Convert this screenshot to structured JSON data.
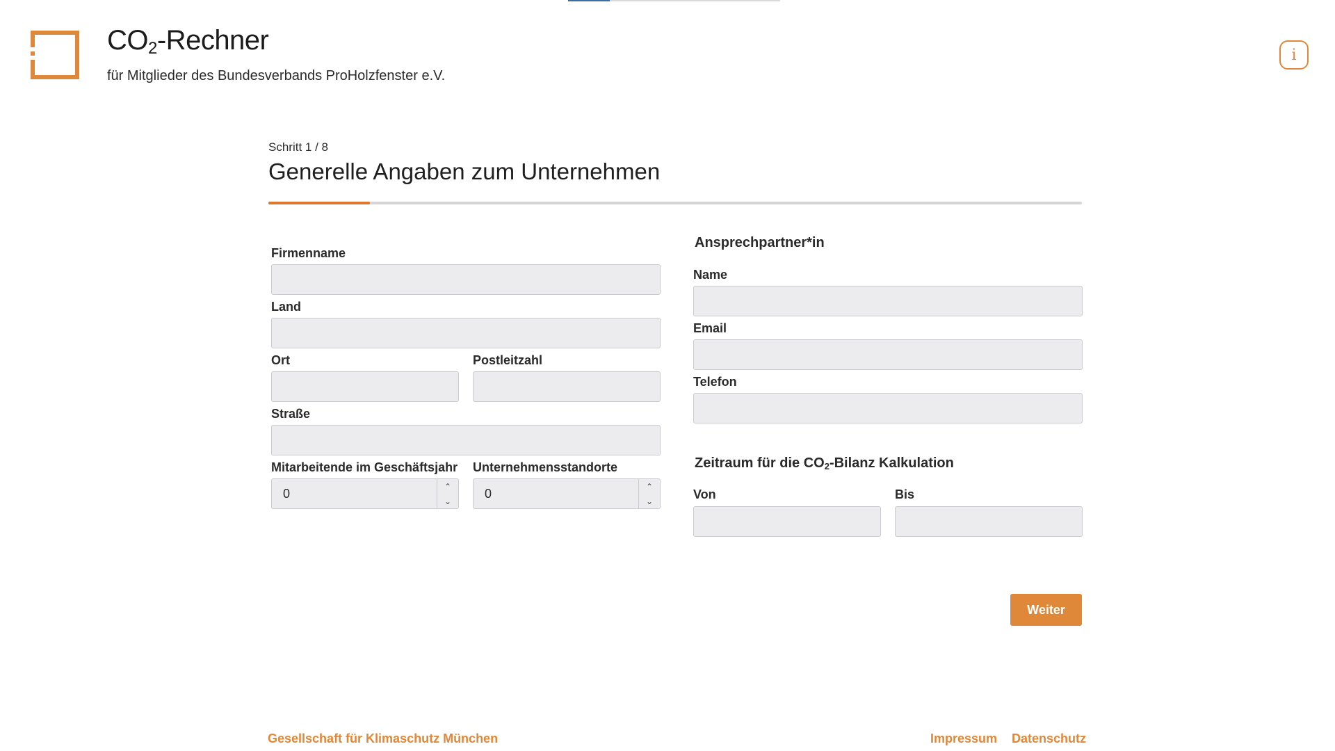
{
  "header": {
    "title_main": "CO",
    "title_sub": "2",
    "title_rest": "-Rechner",
    "subtitle": "für Mitglieder des Bundesverbands ProHolzfenster e.V.",
    "info_icon": "i"
  },
  "step": {
    "label": "Schritt 1 / 8",
    "title": "Generelle Angaben zum Unternehmen",
    "progress_fraction": 0.125
  },
  "company": {
    "firmenname_label": "Firmenname",
    "land_label": "Land",
    "ort_label": "Ort",
    "plz_label": "Postleitzahl",
    "strasse_label": "Straße",
    "mitarbeitende_label": "Mitarbeitende im Geschäftsjahr",
    "mitarbeitende_value": "0",
    "standorte_label": "Unternehmensstandorte",
    "standorte_value": "0"
  },
  "contact": {
    "section_title": "Ansprechpartner*in",
    "name_label": "Name",
    "email_label": "Email",
    "telefon_label": "Telefon"
  },
  "period": {
    "title_main": "Zeitraum für die CO",
    "title_sub": "2",
    "title_rest": "-Bilanz Kalkulation",
    "von_label": "Von",
    "bis_label": "Bis"
  },
  "actions": {
    "next_label": "Weiter"
  },
  "footer": {
    "org_link": "Gesellschaft für Klimaschutz München",
    "impressum_link": "Impressum",
    "datenschutz_link": "Datenschutz"
  },
  "colors": {
    "accent": "#e0883a",
    "progress_fill": "#d9782e",
    "input_bg": "#ececee"
  }
}
